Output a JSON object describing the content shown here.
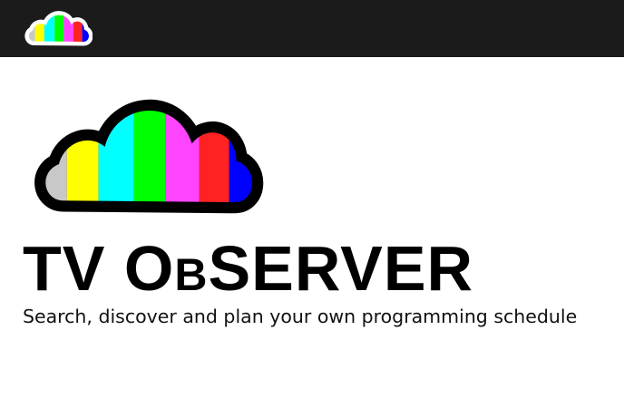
{
  "header": {
    "logo_icon": "cloud-color-bars-logo-icon"
  },
  "hero": {
    "logo_icon": "cloud-color-bars-logo-icon",
    "title": {
      "part1": "TV O",
      "part2": "B",
      "part3": "SERVER"
    },
    "tagline": "Search, discover and plan your own programming schedule"
  },
  "colors": {
    "topbar_bg": "#1b1b1b",
    "bar_gray": "#c8c8c8",
    "bar_yellow": "#ffff00",
    "bar_cyan": "#00ffff",
    "bar_green": "#00ff00",
    "bar_magenta": "#ff44ff",
    "bar_red": "#ff2222",
    "bar_blue": "#0000ff"
  }
}
